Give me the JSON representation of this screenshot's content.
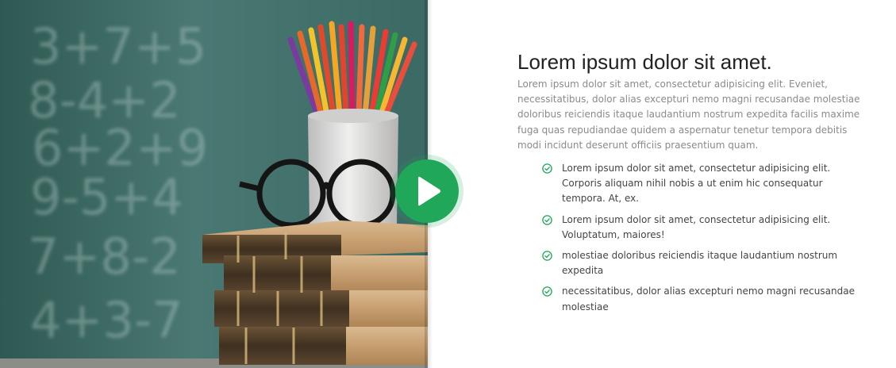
{
  "hero": {
    "title": "Lorem ipsum dolor sit amet.",
    "intro": "Lorem ipsum dolor sit amet, consectetur adipisicing elit. Eveniet, necessitatibus, dolor alias excepturi nemo magni recusandae molestiae doloribus reiciendis itaque laudantium nostrum expedita facilis maxime fuga quas repudiandae quidem a aspernatur tenetur tempora debitis modi incidunt deserunt officiis praesentium quam."
  },
  "features": [
    {
      "icon": "check-circle-icon",
      "text": "Lorem ipsum dolor sit amet, consectetur adipisicing elit. Corporis aliquam nihil nobis a ut enim hic consequatur tempora. At, ex."
    },
    {
      "icon": "check-circle-icon",
      "text": "Lorem ipsum dolor sit amet, consectetur adipisicing elit. Voluptatum, maiores!"
    },
    {
      "icon": "check-circle-icon",
      "text": "molestiae doloribus reiciendis itaque laudantium nostrum expedita"
    },
    {
      "icon": "check-circle-icon",
      "text": "necessitatibus, dolor alias excepturi nemo magni recusandae molestiae"
    }
  ],
  "media": {
    "chalkboard_lines": [
      "3+7+5",
      "8-4+2",
      "6+2+9",
      "9-5+4",
      "7+8-2",
      "4+3-7"
    ],
    "play_icon": "play-icon"
  },
  "colors": {
    "accent": "#20a75a",
    "title": "#222222",
    "intro_text": "#8a8a8a",
    "list_text": "#444444",
    "chalkboard": "#3e6a64"
  }
}
